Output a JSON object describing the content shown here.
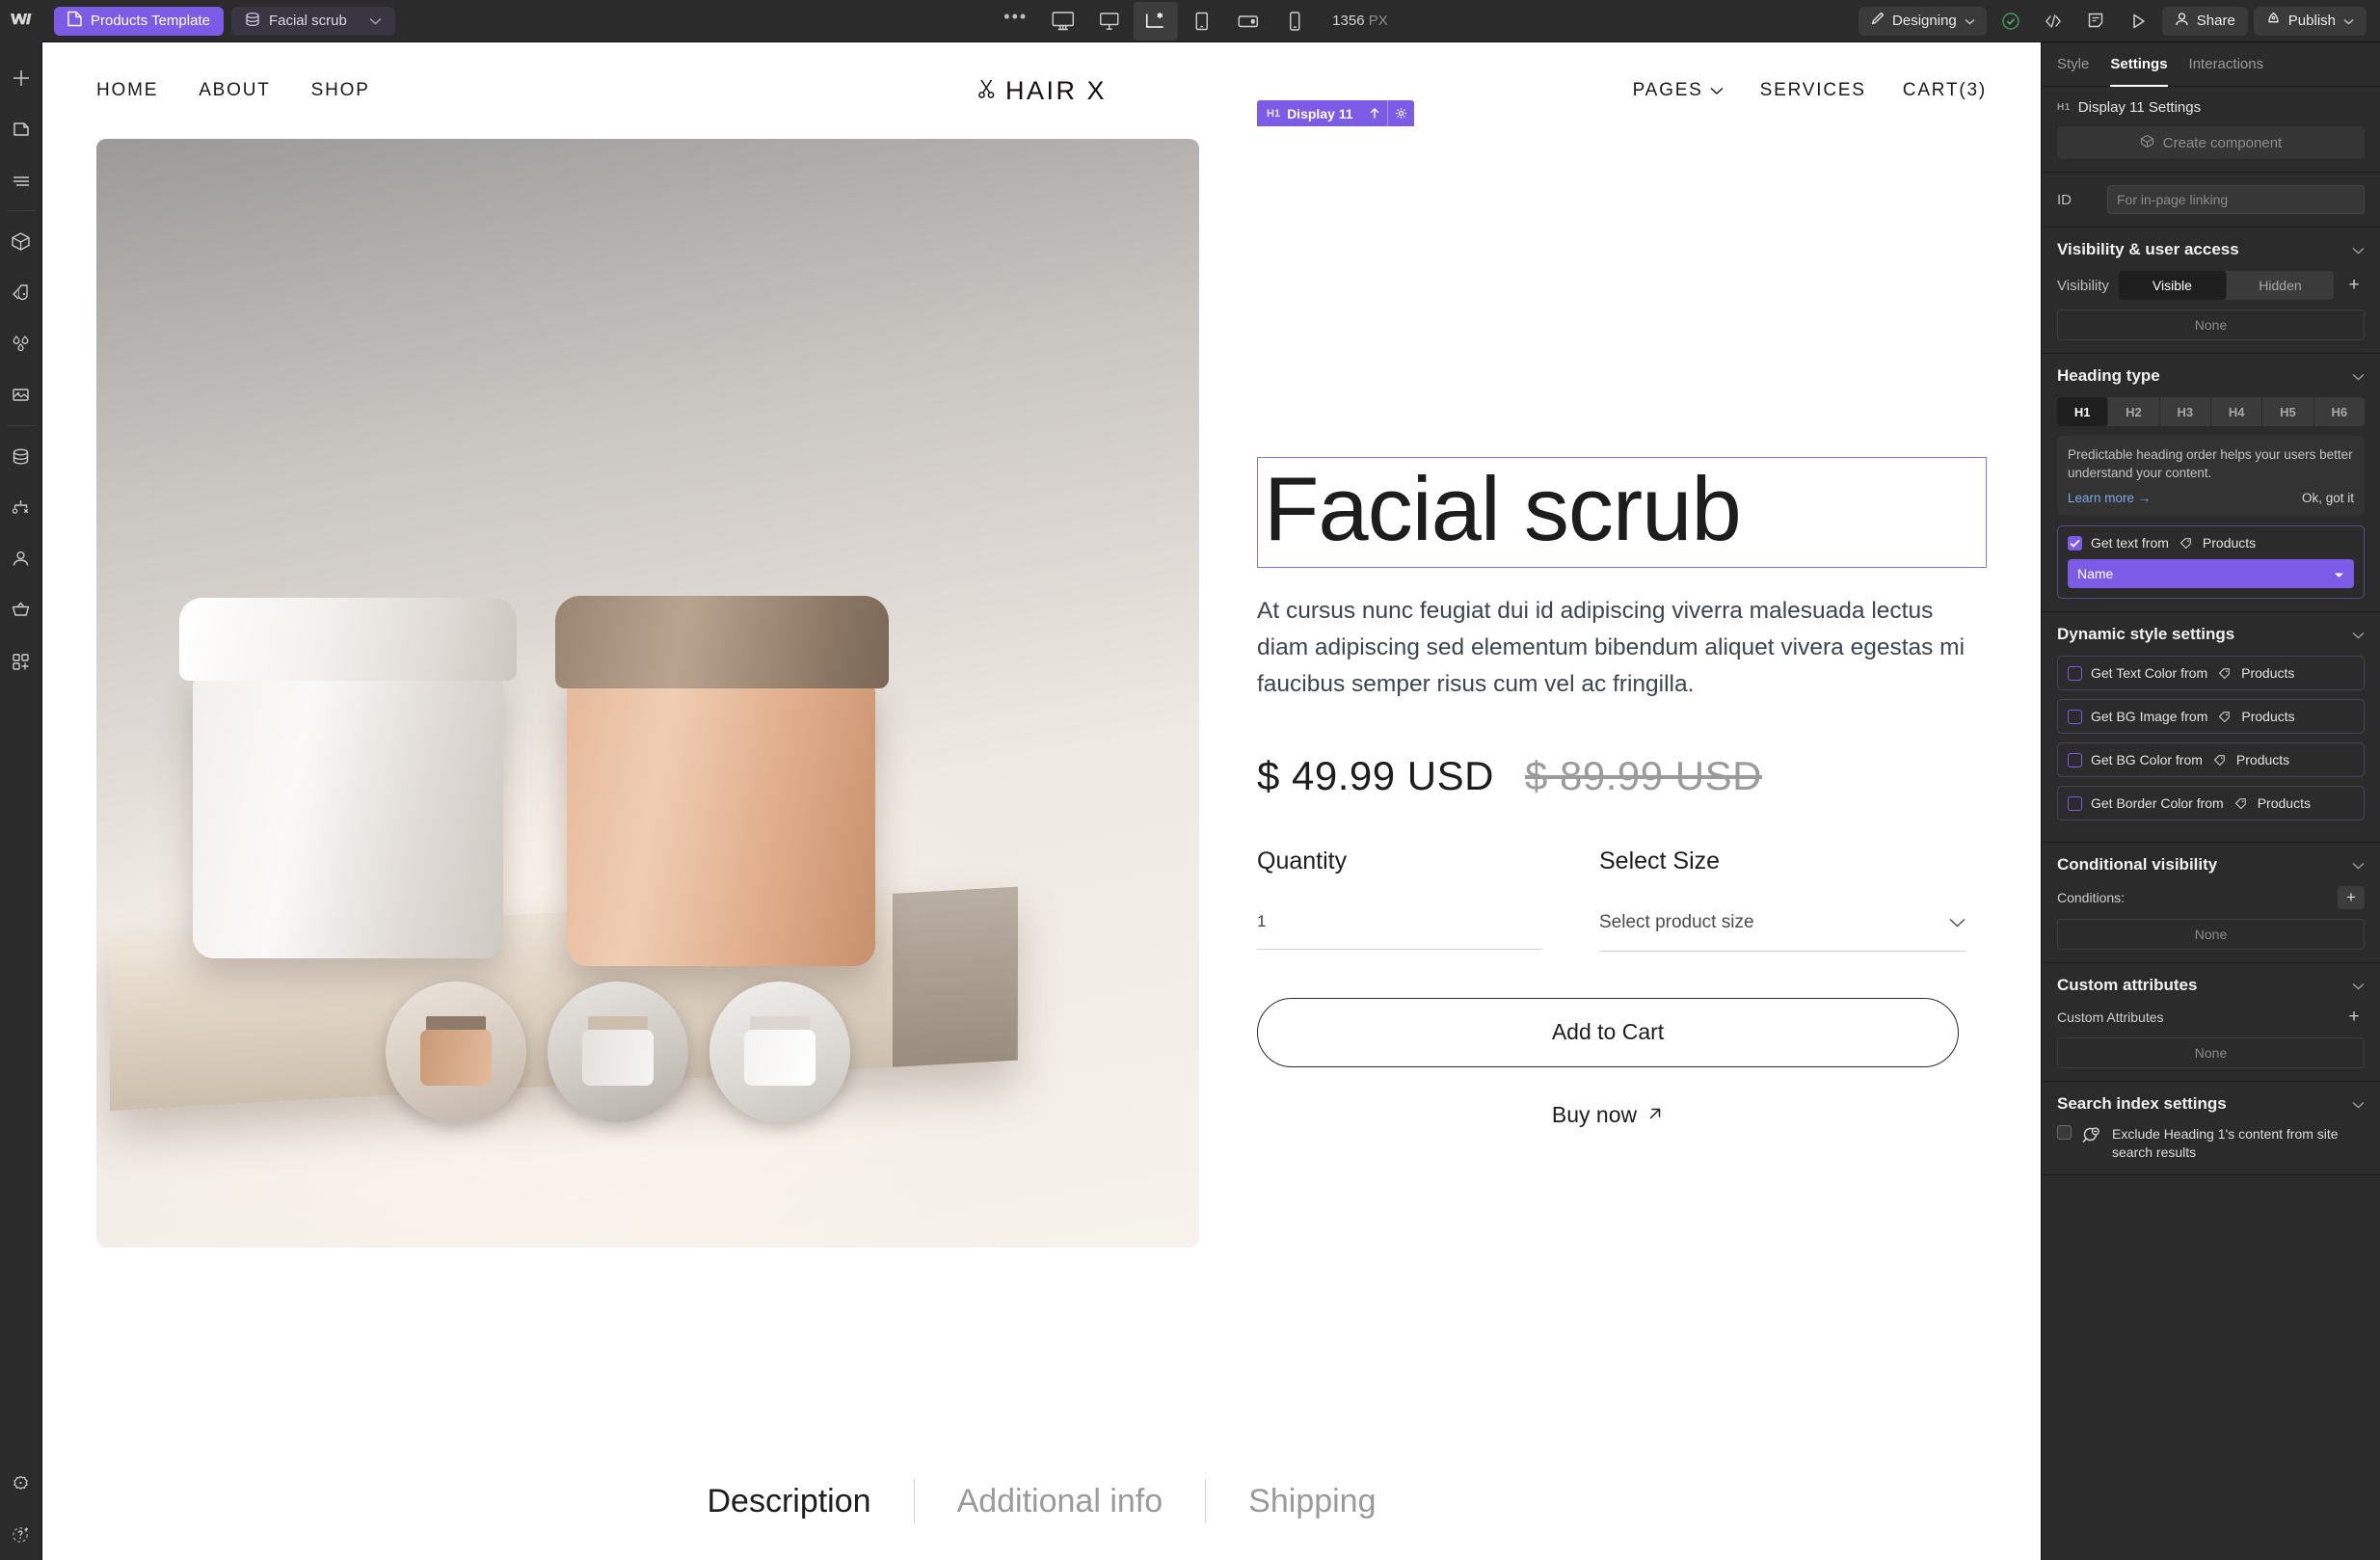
{
  "topbar": {
    "logo_icon": "webflow-logo-icon",
    "page_tab": {
      "label": "Products Template",
      "icon": "page-icon"
    },
    "cms_tab": {
      "label": "Facial scrub",
      "icon": "database-icon",
      "chevron": "chevron-down-icon"
    },
    "overflow_icon": "ellipsis-icon",
    "breakpoints": [
      {
        "name": "breakpoint-desktop-xl",
        "icon": "monitor-icon",
        "selected": false
      },
      {
        "name": "breakpoint-desktop",
        "icon": "monitor-small-icon",
        "selected": false
      },
      {
        "name": "breakpoint-base",
        "icon": "base-breakpoint-icon",
        "selected": true
      },
      {
        "name": "breakpoint-tablet",
        "icon": "tablet-icon",
        "selected": false
      },
      {
        "name": "breakpoint-mobile-landscape",
        "icon": "mobile-landscape-icon",
        "selected": false
      },
      {
        "name": "breakpoint-mobile-portrait",
        "icon": "mobile-portrait-icon",
        "selected": false
      }
    ],
    "viewport_width": "1356",
    "viewport_unit": "PX",
    "mode": {
      "label": "Designing",
      "icon": "brush-icon",
      "chevron": "chevron-down-icon"
    },
    "status_icon": "check-circle-icon",
    "code_icon": "code-icon",
    "comment_icon": "comment-icon",
    "preview_icon": "play-icon",
    "share": {
      "label": "Share",
      "icon": "person-icon"
    },
    "publish": {
      "label": "Publish",
      "icon": "rocket-icon",
      "chevron": "chevron-down-icon"
    }
  },
  "rail": {
    "items": [
      {
        "name": "add-elements-icon",
        "title": "Add"
      },
      {
        "name": "pages-icon",
        "title": "Pages"
      },
      {
        "name": "navigator-icon",
        "title": "Navigator"
      },
      {
        "name": "components-icon",
        "title": "Components"
      },
      {
        "name": "style-selectors-icon",
        "title": "Style"
      },
      {
        "name": "variables-icon",
        "title": "Variables"
      },
      {
        "name": "assets-icon",
        "title": "Assets"
      },
      {
        "name": "cms-icon",
        "title": "CMS"
      },
      {
        "name": "logic-icon",
        "title": "Logic"
      },
      {
        "name": "users-icon",
        "title": "Users"
      },
      {
        "name": "ecommerce-icon",
        "title": "Ecommerce"
      },
      {
        "name": "apps-icon",
        "title": "Apps"
      }
    ],
    "bottom": [
      {
        "name": "settings-gear-icon",
        "title": "Settings"
      },
      {
        "name": "help-ai-icon",
        "title": "Help"
      }
    ]
  },
  "canvas": {
    "nav": {
      "left_links": [
        "HOME",
        "ABOUT",
        "SHOP"
      ],
      "brand": "HAIR X",
      "brand_icon": "scissors-icon",
      "right_links": [
        {
          "label": "PAGES",
          "chevron": "chevron-down-icon"
        },
        {
          "label": "SERVICES",
          "chevron": ""
        },
        {
          "label": "CART(3)",
          "chevron": ""
        }
      ]
    },
    "selection_badge": {
      "tag": "H1",
      "label": "Display 11",
      "up_icon": "move-up-icon",
      "gear_icon": "gear-icon"
    },
    "product": {
      "title": "Facial scrub",
      "description": "At cursus nunc feugiat dui id adipiscing viverra malesuada lectus diam adipiscing sed elementum bibendum aliquet vivera egestas mi faucibus semper risus cum vel ac fringilla.",
      "price_current": "$ 49.99 USD",
      "price_compare": "$ 89.99 USD",
      "quantity_label": "Quantity",
      "quantity_value": "1",
      "size_label": "Select Size",
      "size_placeholder": "Select product size",
      "size_chevron": "chevron-down-icon",
      "add_to_cart": "Add to Cart",
      "buy_now": "Buy now",
      "buy_now_icon": "arrow-up-right-icon"
    },
    "tabs": [
      {
        "label": "Description",
        "active": true
      },
      {
        "label": "Additional info",
        "active": false
      },
      {
        "label": "Shipping",
        "active": false
      }
    ]
  },
  "right_panel": {
    "tabs": [
      {
        "label": "Style",
        "active": false
      },
      {
        "label": "Settings",
        "active": true
      },
      {
        "label": "Interactions",
        "active": false
      }
    ],
    "element_tag": "H1",
    "element_title": "Display 11 Settings",
    "create_component": {
      "label": "Create component",
      "icon": "component-cube-icon"
    },
    "id_label": "ID",
    "id_placeholder": "For in-page linking",
    "visibility": {
      "heading": "Visibility & user access",
      "label": "Visibility",
      "options": [
        {
          "label": "Visible",
          "active": true
        },
        {
          "label": "Hidden",
          "active": false
        }
      ],
      "add_icon": "plus-icon",
      "value": "None"
    },
    "heading_type": {
      "heading": "Heading type",
      "options": [
        {
          "label": "H1",
          "active": true
        },
        {
          "label": "H2",
          "active": false
        },
        {
          "label": "H3",
          "active": false
        },
        {
          "label": "H4",
          "active": false
        },
        {
          "label": "H5",
          "active": false
        },
        {
          "label": "H6",
          "active": false
        }
      ],
      "hint_text": "Predictable heading order helps your users better understand your content.",
      "hint_link": "Learn more →",
      "hint_dismiss": "Ok, got it"
    },
    "get_text": {
      "label": "Get text from",
      "collection": "Products",
      "checked": true,
      "field_value": "Name",
      "field_chevron": "chevron-down-icon",
      "tag_icon": "cms-tag-icon"
    },
    "dynamic_style": {
      "heading": "Dynamic style settings",
      "items": [
        {
          "label": "Get Text Color from",
          "collection": "Products",
          "checked": false
        },
        {
          "label": "Get BG Image from",
          "collection": "Products",
          "checked": false
        },
        {
          "label": "Get BG Color from",
          "collection": "Products",
          "checked": false
        },
        {
          "label": "Get Border Color from",
          "collection": "Products",
          "checked": false
        }
      ]
    },
    "conditional_visibility": {
      "heading": "Conditional visibility",
      "conditions_label": "Conditions:",
      "add_icon": "plus-icon",
      "value": "None"
    },
    "custom_attributes": {
      "heading": "Custom attributes",
      "label": "Custom Attributes",
      "add_icon": "plus-icon",
      "value": "None"
    },
    "search_index": {
      "heading": "Search index settings",
      "icon": "search-exclude-icon",
      "label": "Exclude Heading 1's content from site search results",
      "checked": false
    }
  }
}
